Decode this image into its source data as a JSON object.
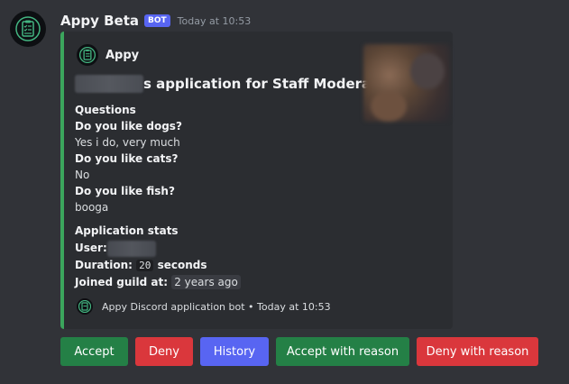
{
  "message": {
    "username": "Appy Beta",
    "bot_badge": "BOT",
    "timestamp": "Today at 10:53"
  },
  "embed": {
    "accent_color": "#3ba55c",
    "author": "Appy",
    "title_suffix": "s application for Staff Moderator",
    "questions_header": "Questions",
    "questions": [
      {
        "q": "Do you like dogs?",
        "a": "Yes i do, very much"
      },
      {
        "q": "Do you like cats?",
        "a": "No"
      },
      {
        "q": "Do you like fish?",
        "a": "booga"
      }
    ],
    "stats_header": "Application stats",
    "user_label": "User:",
    "duration_label": "Duration:",
    "duration_value": "20",
    "duration_unit": " seconds",
    "joined_label": "Joined guild at:",
    "joined_value": "2 years ago",
    "footer_text": "Appy Discord application bot • Today at 10:53"
  },
  "buttons": [
    {
      "label": "Accept",
      "color": "#248046"
    },
    {
      "label": "Deny",
      "color": "#da373c"
    },
    {
      "label": "History",
      "color": "#5865f2"
    },
    {
      "label": "Accept with reason",
      "color": "#248046"
    },
    {
      "label": "Deny with reason",
      "color": "#da373c"
    }
  ],
  "icons": {
    "avatar": "clipboard-icon",
    "author": "clipboard-icon",
    "footer": "clipboard-icon"
  }
}
